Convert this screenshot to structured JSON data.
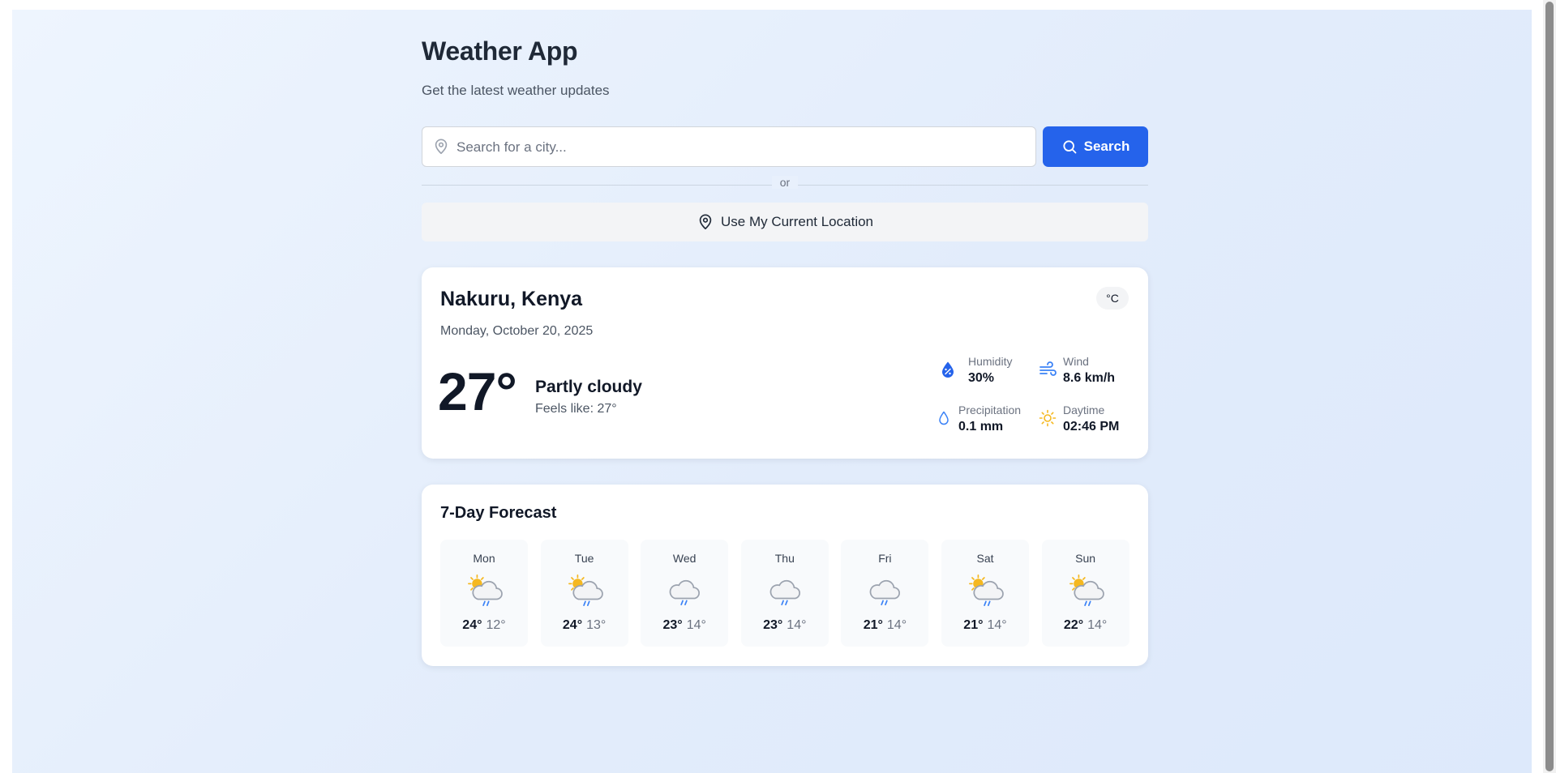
{
  "header": {
    "title": "Weather App",
    "subtitle": "Get the latest weather updates"
  },
  "search": {
    "placeholder": "Search for a city...",
    "value": "",
    "button_label": "Search",
    "divider_label": "or",
    "location_button_label": "Use My Current Location"
  },
  "current": {
    "city": "Nakuru, Kenya",
    "date": "Monday, October 20, 2025",
    "unit": "°C",
    "temperature": "27°",
    "condition": "Partly cloudy",
    "feels_like_label": "Feels like:",
    "feels_like": "27°",
    "stats": {
      "humidity": {
        "label": "Humidity",
        "value": "30%",
        "icon": "humidity-icon"
      },
      "wind": {
        "label": "Wind",
        "value": "8.6 km/h",
        "icon": "wind-icon"
      },
      "precipitation": {
        "label": "Precipitation",
        "value": "0.1 mm",
        "icon": "raindrop-icon"
      },
      "daytime": {
        "label": "Daytime",
        "value": "02:46 PM",
        "icon": "sun-icon"
      }
    }
  },
  "forecast": {
    "title": "7-Day Forecast",
    "days": [
      {
        "day": "Mon",
        "high": "24°",
        "low": "12°",
        "icon": "partly-cloudy-rain-icon"
      },
      {
        "day": "Tue",
        "high": "24°",
        "low": "13°",
        "icon": "partly-cloudy-rain-icon"
      },
      {
        "day": "Wed",
        "high": "23°",
        "low": "14°",
        "icon": "cloud-rain-icon"
      },
      {
        "day": "Thu",
        "high": "23°",
        "low": "14°",
        "icon": "cloud-rain-icon"
      },
      {
        "day": "Fri",
        "high": "21°",
        "low": "14°",
        "icon": "cloud-rain-icon"
      },
      {
        "day": "Sat",
        "high": "21°",
        "low": "14°",
        "icon": "partly-cloudy-rain-icon"
      },
      {
        "day": "Sun",
        "high": "22°",
        "low": "14°",
        "icon": "partly-cloudy-rain-icon"
      }
    ]
  },
  "colors": {
    "primary": "#2563eb",
    "background": "#e8f0fc",
    "card": "#ffffff",
    "sun": "#f5b820",
    "cloud": "#9ca3af",
    "rain": "#3b82f6"
  }
}
